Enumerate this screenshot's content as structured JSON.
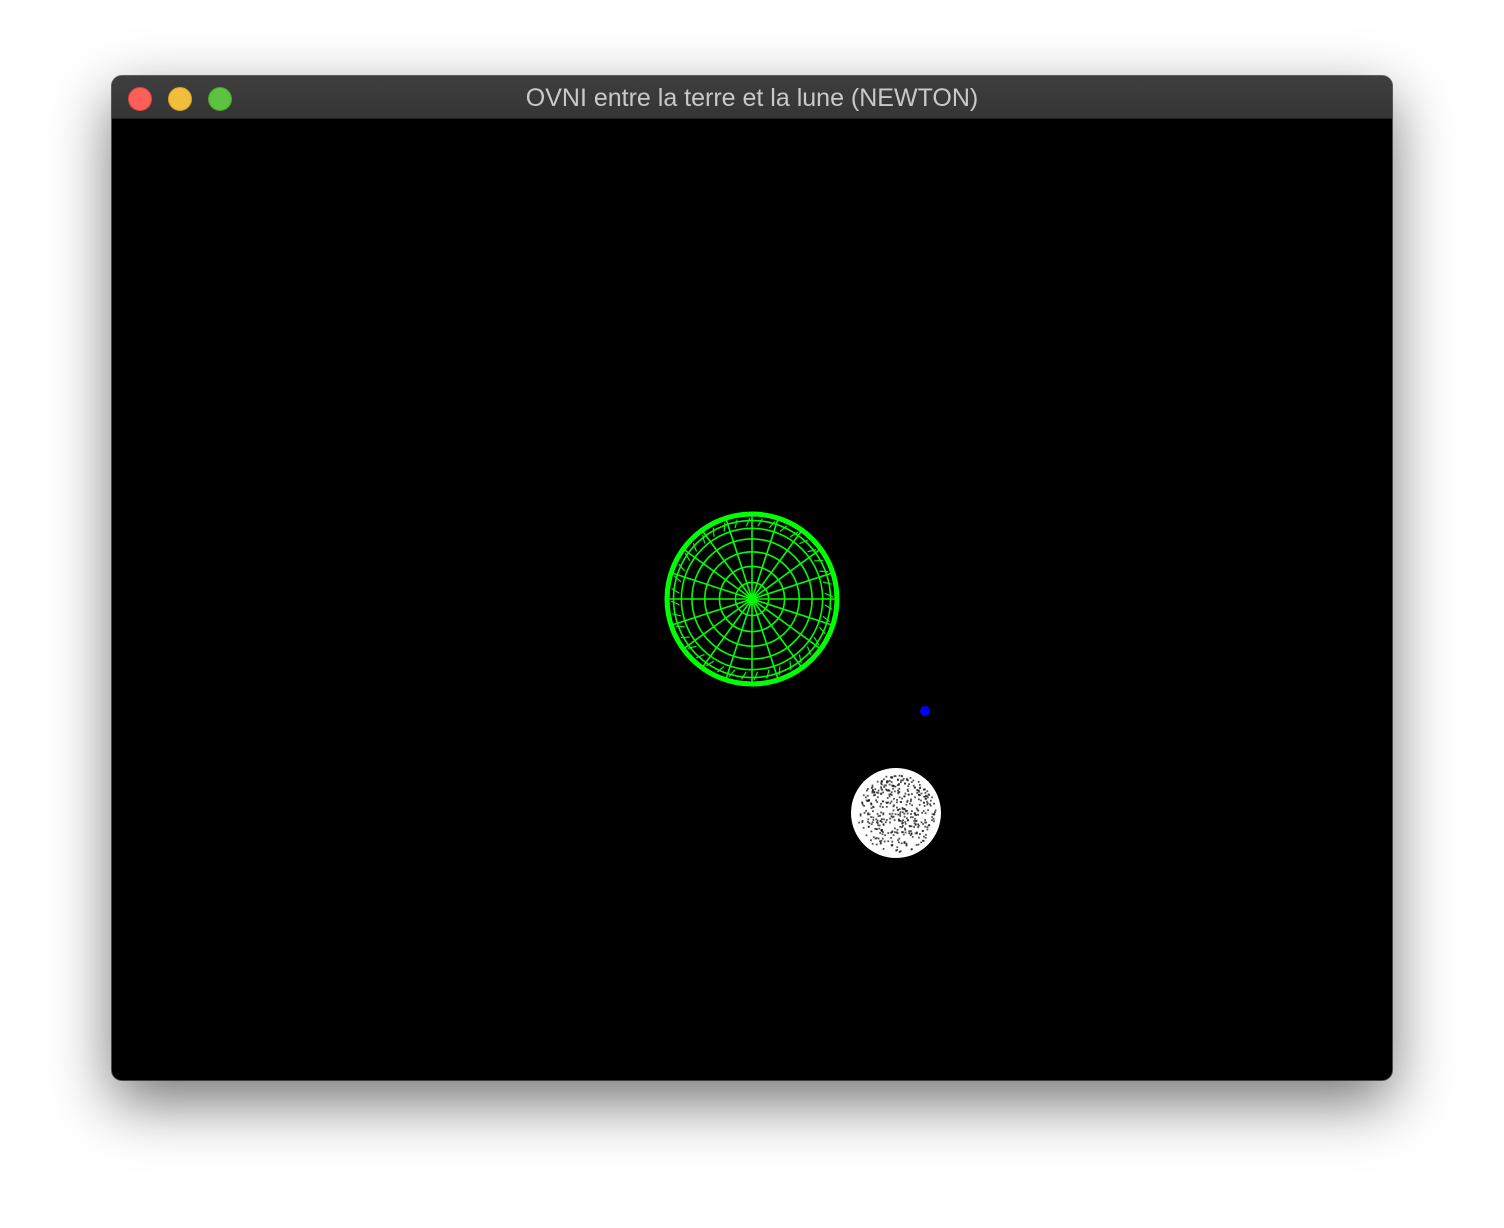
{
  "window": {
    "title": "OVNI entre la terre et la lune (NEWTON)",
    "controls": {
      "close_color": "#fe5f57",
      "minimize_color": "#f0be3a",
      "zoom_color": "#5ec13f"
    }
  },
  "scene": {
    "background": "#000000",
    "bodies": [
      {
        "id": "earth",
        "style": "wireframe-sphere",
        "color": "#00ff00"
      },
      {
        "id": "moon",
        "style": "dotted-sphere",
        "color": "#ffffff"
      },
      {
        "id": "ufo",
        "style": "point",
        "color": "#0000ff"
      }
    ]
  }
}
